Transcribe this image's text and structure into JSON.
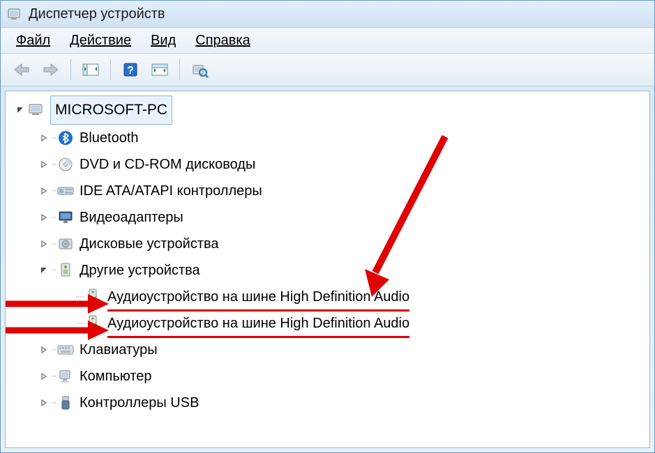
{
  "window": {
    "title": "Диспетчер устройств"
  },
  "menu": {
    "file": "Файл",
    "action": "Действие",
    "view": "Вид",
    "help": "Справка"
  },
  "tree": {
    "root": "MICROSOFT-PC",
    "items": [
      {
        "label": "Bluetooth",
        "icon": "bluetooth"
      },
      {
        "label": "DVD и CD-ROM дисководы",
        "icon": "disc"
      },
      {
        "label": "IDE ATA/ATAPI контроллеры",
        "icon": "ide"
      },
      {
        "label": "Видеоадаптеры",
        "icon": "display"
      },
      {
        "label": "Дисковые устройства",
        "icon": "hdd"
      },
      {
        "label": "Другие устройства",
        "icon": "other",
        "expanded": true,
        "children": [
          {
            "label": "Аудиоустройство на шине High Definition Audio",
            "icon": "warn",
            "highlight": true
          },
          {
            "label": "Аудиоустройство на шине High Definition Audio",
            "icon": "warn",
            "highlight": true
          }
        ]
      },
      {
        "label": "Клавиатуры",
        "icon": "keyboard"
      },
      {
        "label": "Компьютер",
        "icon": "computer"
      },
      {
        "label": "Контроллеры USB",
        "icon": "usb"
      }
    ]
  }
}
